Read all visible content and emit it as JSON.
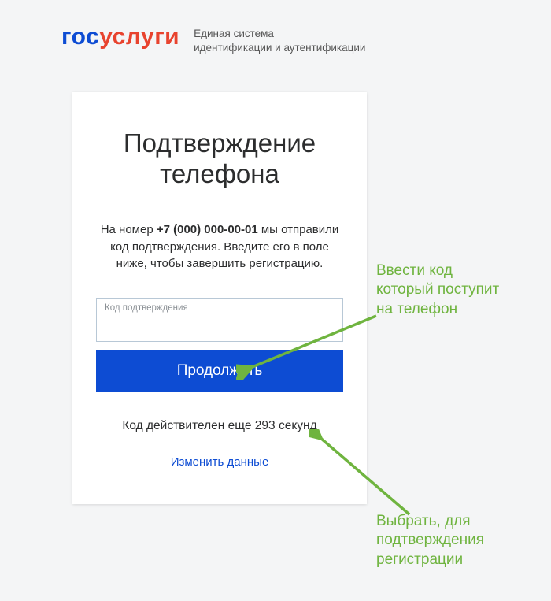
{
  "logo": {
    "part1": "гос",
    "part2": "услуги"
  },
  "tagline": {
    "line1": "Единая система",
    "line2": "идентификации и аутентификации"
  },
  "title": {
    "line1": "Подтверждение",
    "line2": "телефона"
  },
  "msg": {
    "pre": "На номер ",
    "phone": "+7 (000) 000-00-01",
    "suf": " мы отправили код подтверждения. Введите его в поле ниже, чтобы завершить регистрацию."
  },
  "input": {
    "label": "Код подтверждения",
    "value": ""
  },
  "continue_label": "Продолжить",
  "validity": {
    "pre": "Код действителен еще ",
    "seconds": "293",
    "suf": " секунд"
  },
  "change_label": "Изменить данные",
  "annotations": {
    "note1_l1": "Ввести код",
    "note1_l2": "который поступит",
    "note1_l3": "на телефон",
    "note2_l1": "Выбрать, для",
    "note2_l2": "подтверждения",
    "note2_l3": "регистрации"
  },
  "colors": {
    "accent": "#0d4cd3",
    "brand_red": "#e8432e",
    "annotation": "#6fb43f"
  }
}
